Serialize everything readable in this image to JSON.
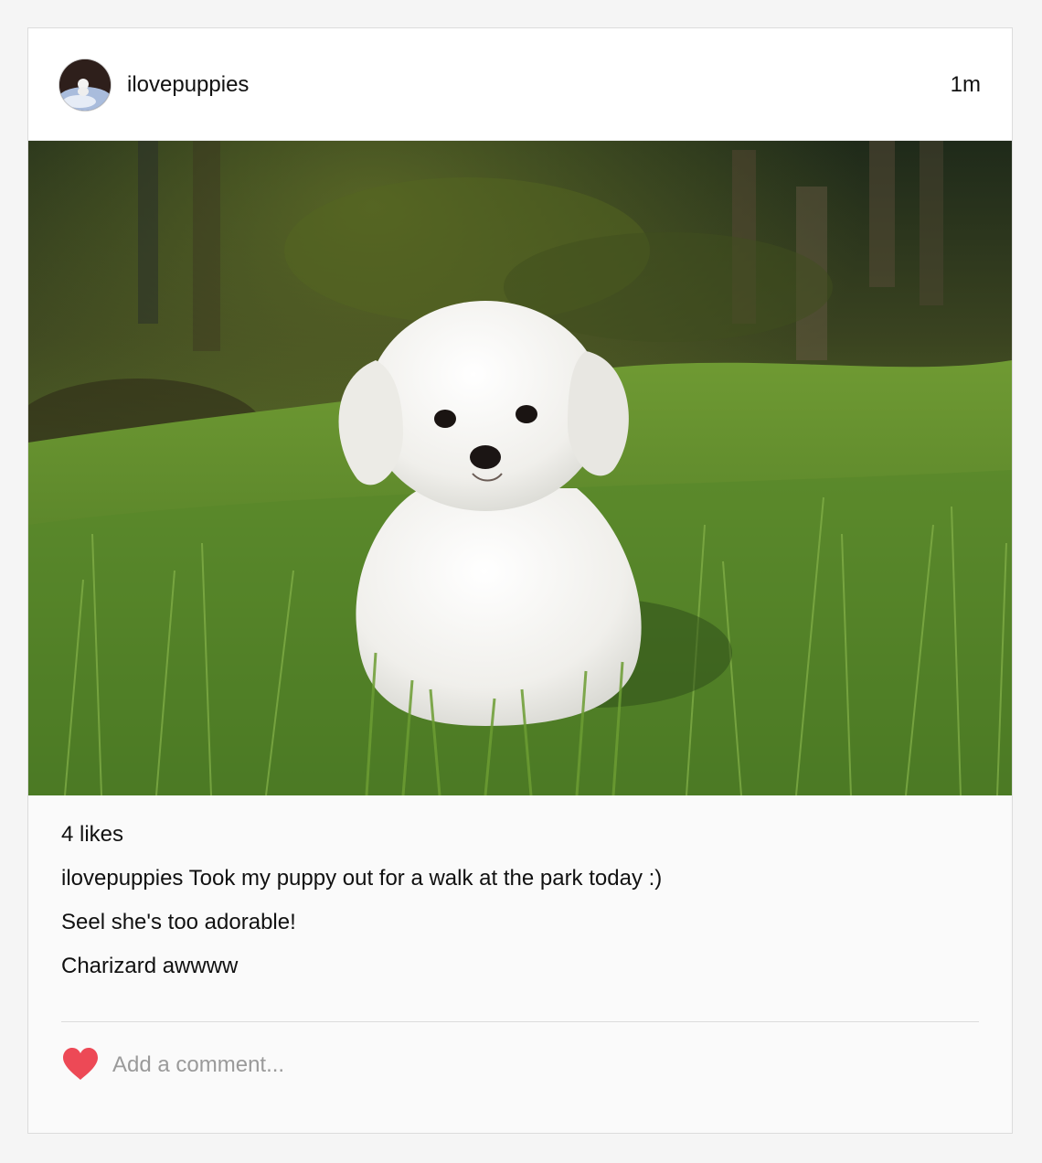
{
  "post": {
    "username": "ilovepuppies",
    "timestamp": "1m",
    "photo_icon": "puppy-photo",
    "likes_text": "4 likes",
    "caption": {
      "author": "ilovepuppies",
      "text": "Took my puppy out for a walk at the park today :)"
    },
    "comments": [
      {
        "text": "Seel she's too adorable!"
      },
      {
        "text": "Charizard awwww"
      }
    ],
    "comment_input": {
      "placeholder": "Add a comment...",
      "value": ""
    },
    "like_icon": "heart-icon",
    "like_color": "#ed4956"
  }
}
